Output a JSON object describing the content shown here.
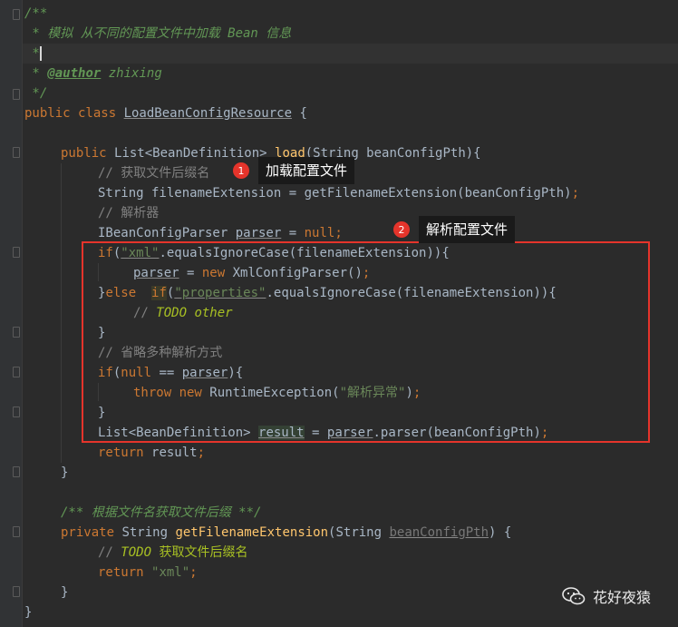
{
  "code": {
    "l1": "/**",
    "l2": " * 模拟 从不同的配置文件中加载 Bean 信息",
    "l3": " *",
    "l4_star": " * ",
    "l4_tag": "@author",
    "l4_name": " zhixing",
    "l5": " */",
    "l6_kw": "public class ",
    "l6_cls": "LoadBeanConfigResource",
    "l6_rest": " {",
    "l8_kw": "public ",
    "l8_type": "List<BeanDefinition> ",
    "l8_fn": "load",
    "l8_rest": "(String beanConfigPth){",
    "l9": "// 获取文件后缀名",
    "l10_a": "String filenameExtension = getFilenameExtension(beanConfigPth)",
    "l10_b": ";",
    "l11": "// 解析器",
    "l12_a": "IBeanConfigParser ",
    "l12_var": "parser",
    "l12_b": " = ",
    "l12_null": "null",
    "l12_c": ";",
    "l13_if": "if",
    "l13_str": "\"xml\"",
    "l13_rest": ".equalsIgnoreCase(filenameExtension)){",
    "l14_var": "parser",
    "l14_a": " = ",
    "l14_new": "new ",
    "l14_b": "XmlConfigParser()",
    "l14_c": ";",
    "l15_a": "}",
    "l15_else": "else  ",
    "l15_if": "if",
    "l15_b": "(",
    "l15_str": "\"properties\"",
    "l15_rest": ".equalsIgnoreCase(filenameExtension)){",
    "l16_cm": "// ",
    "l16_todo": "TODO other",
    "l17": "}",
    "l18": "// 省略多种解析方式",
    "l19_if": "if",
    "l19_a": "(",
    "l19_null": "null",
    "l19_b": " == ",
    "l19_var": "parser",
    "l19_c": "){",
    "l20_throw": "throw new ",
    "l20_a": "RuntimeException(",
    "l20_str": "\"解析异常\"",
    "l20_b": ")",
    "l20_c": ";",
    "l21": "}",
    "l22_a": "List<BeanDefinition> ",
    "l22_res": "result",
    "l22_b": " = ",
    "l22_var": "parser",
    "l22_c": ".parser(beanConfigPth)",
    "l22_d": ";",
    "l23_ret": "return ",
    "l23_a": "result",
    "l23_b": ";",
    "l24": "}",
    "l26": "/** 根据文件名获取文件后缀 **/",
    "l27_kw": "private ",
    "l27_a": "String ",
    "l27_fn": "getFilenameExtension",
    "l27_b": "(String ",
    "l27_param": "beanConfigPth",
    "l27_c": ") {",
    "l28_cm": "// ",
    "l28_todo": "TODO ",
    "l28_txt": "获取文件后缀名",
    "l29_ret": "return ",
    "l29_str": "\"xml\"",
    "l29_b": ";",
    "l30": "}",
    "l31": "}"
  },
  "annotations": [
    {
      "number": "1",
      "label": "加载配置文件"
    },
    {
      "number": "2",
      "label": "解析配置文件"
    }
  ],
  "watermark": {
    "text": "花好夜猿",
    "icon": "wechat-icon"
  },
  "colors": {
    "highlight_box": "#e5342b",
    "keyword": "#cc7832",
    "string": "#6a8759",
    "comment": "#808080",
    "background": "#2b2b2b"
  }
}
